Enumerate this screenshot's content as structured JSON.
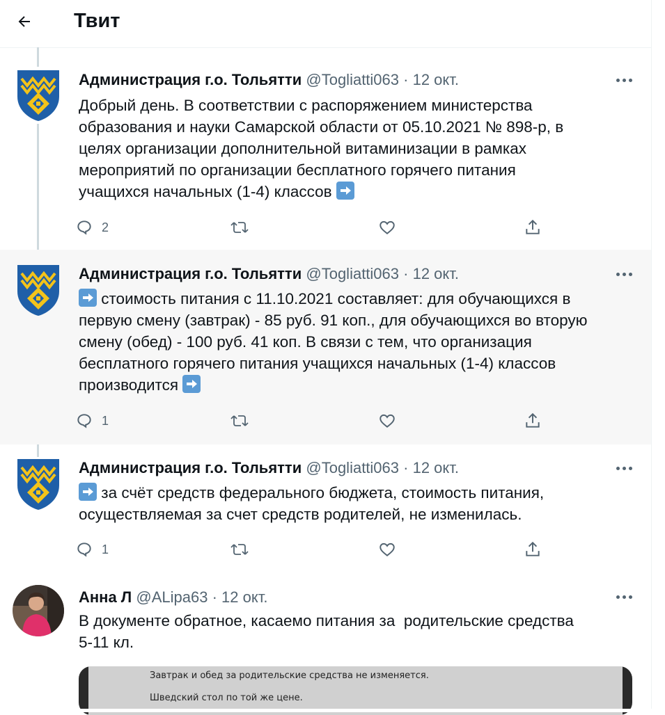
{
  "header": {
    "title": "Твит"
  },
  "tweets": [
    {
      "name": "Администрация г.о. Тольятти",
      "handle": "@Togliatti063",
      "dot": "·",
      "date": "12 окт.",
      "text": "Добрый день. В соответствии с распоряжением министерства\nобразования и науки Самарской области от 05.10.2021 № 898-р, в\nцелях организации дополнительной витаминизации в рамках\nмероприятий по организации бесплатного горячего питания\nучащихся начальных (1-4) классов",
      "replies": "2"
    },
    {
      "name": "Администрация г.о. Тольятти",
      "handle": "@Togliatti063",
      "dot": "·",
      "date": "12 окт.",
      "text_line1": " стоимость питания с 11.10.2021 составляет: для обучающихся в",
      "text_rest": "первую смену (завтрак) - 85 руб. 91 коп., для обучающихся во вторую\nсмену (обед) - 100 руб. 41 коп. В связи с тем, что организация\nбесплатного горячего питания учащихся начальных (1-4) классов\nпроизводится",
      "replies": "1"
    },
    {
      "name": "Администрация г.о. Тольятти",
      "handle": "@Togliatti063",
      "dot": "·",
      "date": "12 окт.",
      "text_line1": " за счёт средств федерального бюджета, стоимость питания,",
      "text_rest": "осуществляемая за счет средств родителей, не изменилась.",
      "replies": "1"
    },
    {
      "name": "Анна Л",
      "handle": "@ALipa63",
      "dot": "·",
      "date": "12 окт.",
      "text": "В документе обратное, касаемо питания за  родительские средства\n5-11 кл.",
      "media_lines": [
        "Завтрак и обед за родительские средства не изменяется.",
        "Шведский стол по той же цене."
      ]
    }
  ],
  "icons": [
    "back-arrow-icon",
    "reply-icon",
    "retweet-icon",
    "like-icon",
    "share-icon",
    "more-icon",
    "arrow-right-emoji"
  ],
  "colors": {
    "accent_emoji": "#5b9bd5",
    "muted": "#536471",
    "highlight_bg": "#f7f7f7",
    "logo_blue": "#1f5fa8",
    "logo_gold": "#f3c31a"
  }
}
